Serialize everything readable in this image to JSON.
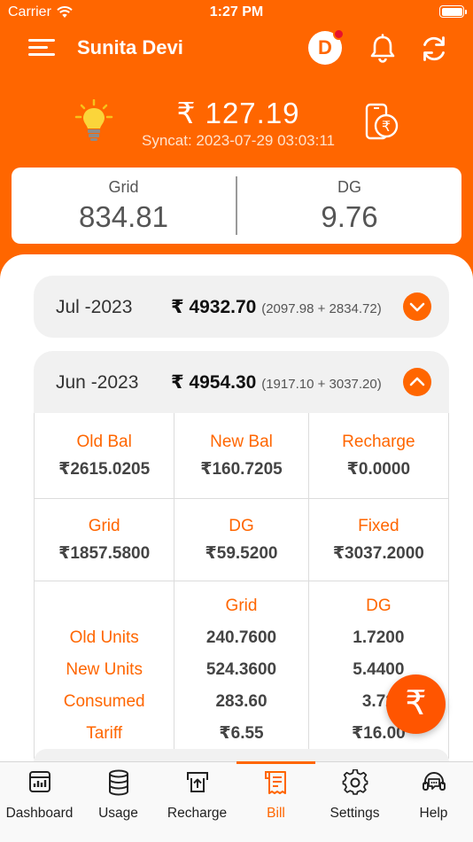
{
  "status_bar": {
    "carrier": "Carrier",
    "time": "1:27 PM"
  },
  "header": {
    "user_name": "Sunita Devi",
    "avatar_initial": "D"
  },
  "balance": {
    "amount": "₹ 127.19",
    "sync_text": "Syncat: 2023-07-29 03:03:11"
  },
  "meter": {
    "grid_label": "Grid",
    "grid_value": "834.81",
    "dg_label": "DG",
    "dg_value": "9.76"
  },
  "months": [
    {
      "name": "Jul -2023",
      "total": "₹ 4932.70",
      "breakdown": "(2097.98 + 2834.72)",
      "expanded": false
    },
    {
      "name": "Jun -2023",
      "total": "₹ 4954.30",
      "breakdown": "(1917.10 + 3037.20)",
      "expanded": true
    }
  ],
  "bill_details": {
    "old_bal_label": "Old Bal",
    "old_bal_value": "₹2615.0205",
    "new_bal_label": "New Bal",
    "new_bal_value": "₹160.7205",
    "recharge_label": "Recharge",
    "recharge_value": "₹0.0000",
    "grid_label": "Grid",
    "grid_value": "₹1857.5800",
    "dg_label": "DG",
    "dg_value": "₹59.5200",
    "fixed_label": "Fixed",
    "fixed_value": "₹3037.2000",
    "units": {
      "col_grid": "Grid",
      "col_dg": "DG",
      "rows": [
        {
          "label": "Old Units",
          "grid": "240.7600",
          "dg": "1.7200"
        },
        {
          "label": "New Units",
          "grid": "524.3600",
          "dg": "5.4400"
        },
        {
          "label": "Consumed",
          "grid": "283.60",
          "dg": "3.72"
        },
        {
          "label": "Tariff",
          "grid": "₹6.55",
          "dg": "₹16.00"
        }
      ]
    }
  },
  "fab_symbol": "₹",
  "nav": [
    {
      "label": "Dashboard",
      "icon": "dashboard-icon"
    },
    {
      "label": "Usage",
      "icon": "database-icon"
    },
    {
      "label": "Recharge",
      "icon": "recharge-icon"
    },
    {
      "label": "Bill",
      "icon": "bill-icon",
      "active": true
    },
    {
      "label": "Settings",
      "icon": "gear-icon"
    },
    {
      "label": "Help",
      "icon": "headset-icon"
    }
  ],
  "colors": {
    "accent": "#ff6600",
    "text_dark": "#333333"
  }
}
